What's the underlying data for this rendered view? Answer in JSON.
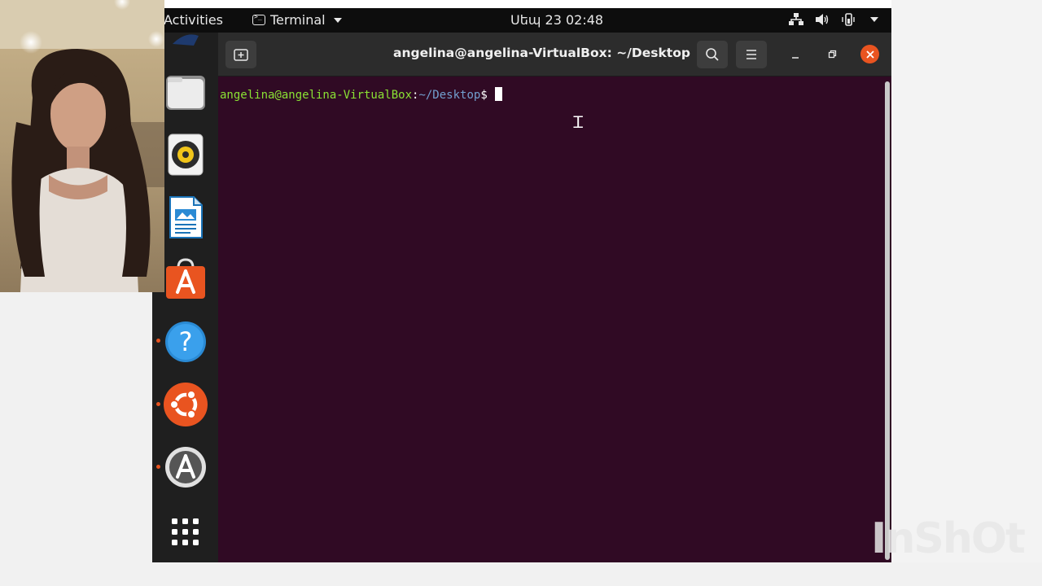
{
  "topbar": {
    "activities": "Activities",
    "app_name": "Terminal",
    "clock": "Սեպ 23  02:48"
  },
  "dock": {
    "items": [
      {
        "name": "Files",
        "icon": "files-icon"
      },
      {
        "name": "Rhythmbox",
        "icon": "rhythmbox-icon"
      },
      {
        "name": "LibreOffice Writer",
        "icon": "writer-icon"
      },
      {
        "name": "Ubuntu Software",
        "icon": "software-icon"
      },
      {
        "name": "Help",
        "icon": "help-icon",
        "running": true
      },
      {
        "name": "Ubuntu",
        "icon": "ubuntu-icon",
        "running": true
      },
      {
        "name": "Software Updater",
        "icon": "updater-icon",
        "running": true
      },
      {
        "name": "Show Applications",
        "icon": "app-grid-icon"
      }
    ]
  },
  "terminal": {
    "title": "angelina@angelina-VirtualBox: ~/Desktop",
    "prompt_user": "angelina@angelina-VirtualBox",
    "prompt_sep": ":",
    "prompt_path": "~/Desktop",
    "prompt_symbol": "$",
    "background": "#300a24",
    "user_color": "#8ae234",
    "path_color": "#729fcf"
  },
  "watermark": "InShOt",
  "colors": {
    "ubuntu_orange": "#e95420",
    "topbar": "#0d0d0d"
  }
}
